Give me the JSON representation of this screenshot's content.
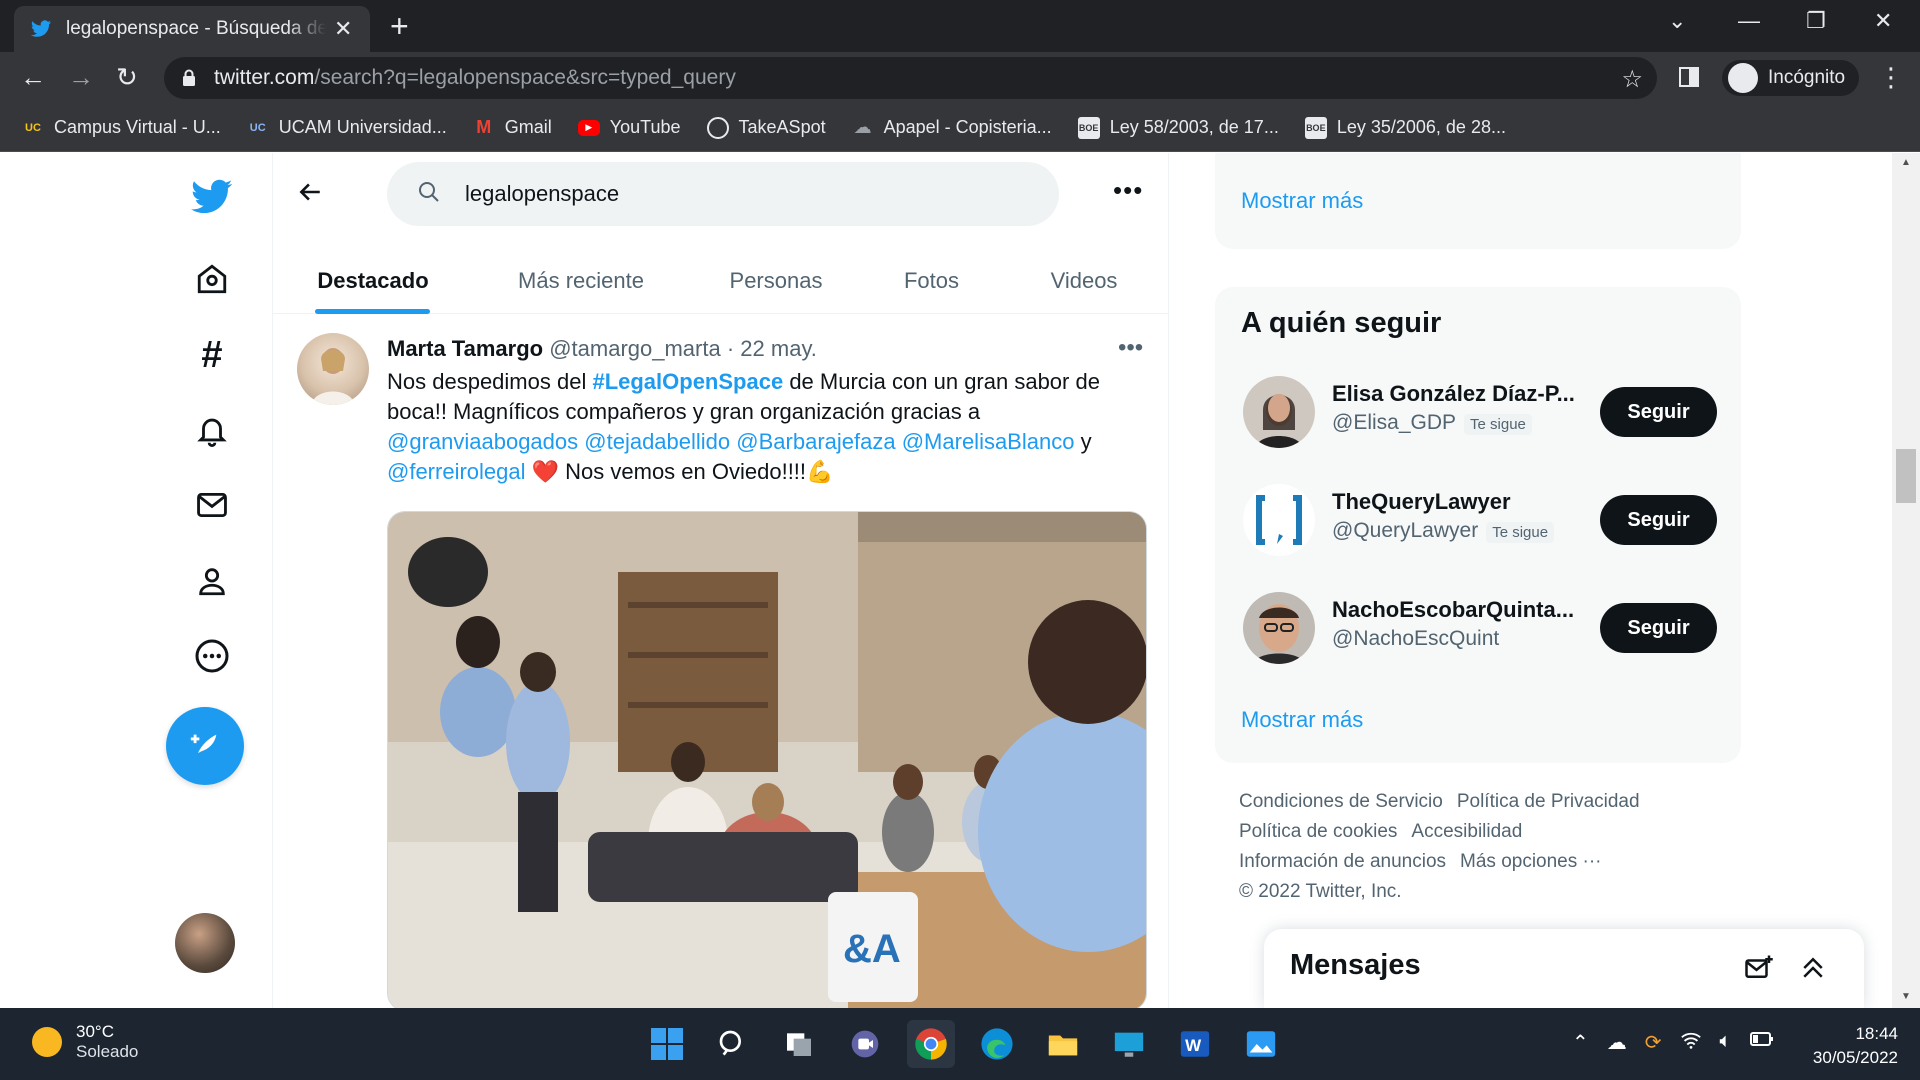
{
  "browser": {
    "tab_title": "legalopenspace - Búsqueda de Twitter",
    "close_glyph": "✕",
    "new_tab_glyph": "+",
    "url_host": "twitter.com",
    "url_path": "/search?q=legalopenspace&src=typed_query",
    "profile_label": "Incógnito",
    "bookmarks": [
      {
        "label": "Campus Virtual - U...",
        "icon": "ucam-icon"
      },
      {
        "label": "UCAM Universidad...",
        "icon": "ucam-icon"
      },
      {
        "label": "Gmail",
        "icon": "gmail-icon"
      },
      {
        "label": "YouTube",
        "icon": "youtube-icon"
      },
      {
        "label": "TakeASpot",
        "icon": "takeaspot-icon"
      },
      {
        "label": "Apapel - Copisteria...",
        "icon": "cloud-icon"
      },
      {
        "label": "Ley 58/2003, de 17...",
        "icon": "boe-icon"
      },
      {
        "label": "Ley 35/2006, de 28...",
        "icon": "boe-icon"
      }
    ]
  },
  "search": {
    "query": "legalopenspace",
    "tabs": [
      "Destacado",
      "Más reciente",
      "Personas",
      "Fotos",
      "Videos"
    ],
    "active_tab": "Destacado"
  },
  "tweet": {
    "name": "Marta Tamargo",
    "handle": "@tamargo_marta",
    "separator": "·",
    "date": "22 may.",
    "text_1": "Nos despedimos del ",
    "hashtag": "#LegalOpenSpace",
    "text_2": " de Murcia con un gran sabor de boca!! Magníficos compañeros y gran organización gracias a ",
    "mentions": [
      "@granviaabogados",
      "@tejadabellido",
      "@Barbarajefaza",
      "@MarelisaBlanco"
    ],
    "text_3": " y ",
    "mention_last": "@ferreirolegal",
    "text_4": " Nos vemos en Oviedo!!!!",
    "heart_emoji": "❤️",
    "muscle_emoji": "💪"
  },
  "sidebar": {
    "top_show_more": "Mostrar más",
    "who_to_follow_title": "A quién seguir",
    "follow_suggestions": [
      {
        "name": "Elisa González Díaz-P...",
        "handle": "@Elisa_GDP",
        "badge": "Te sigue",
        "button": "Seguir"
      },
      {
        "name": "TheQueryLawyer",
        "handle": "@QueryLawyer",
        "badge": "Te sigue",
        "button": "Seguir"
      },
      {
        "name": "NachoEscobarQuinta...",
        "handle": "@NachoEscQuint",
        "badge": "",
        "button": "Seguir"
      }
    ],
    "show_more": "Mostrar más",
    "footer": [
      "Condiciones de Servicio",
      "Política de Privacidad",
      "Política de cookies",
      "Accesibilidad",
      "Información de anuncios",
      "Más opciones ···",
      "© 2022 Twitter, Inc."
    ],
    "messages_title": "Mensajes"
  },
  "taskbar": {
    "temperature": "30°C",
    "condition": "Soleado",
    "time": "18:44",
    "date": "30/05/2022"
  },
  "colors": {
    "twitter_blue": "#1d9bf0",
    "chrome_dark": "#202124",
    "chrome_toolbar": "#35363a",
    "taskbar": "#1c2530"
  }
}
